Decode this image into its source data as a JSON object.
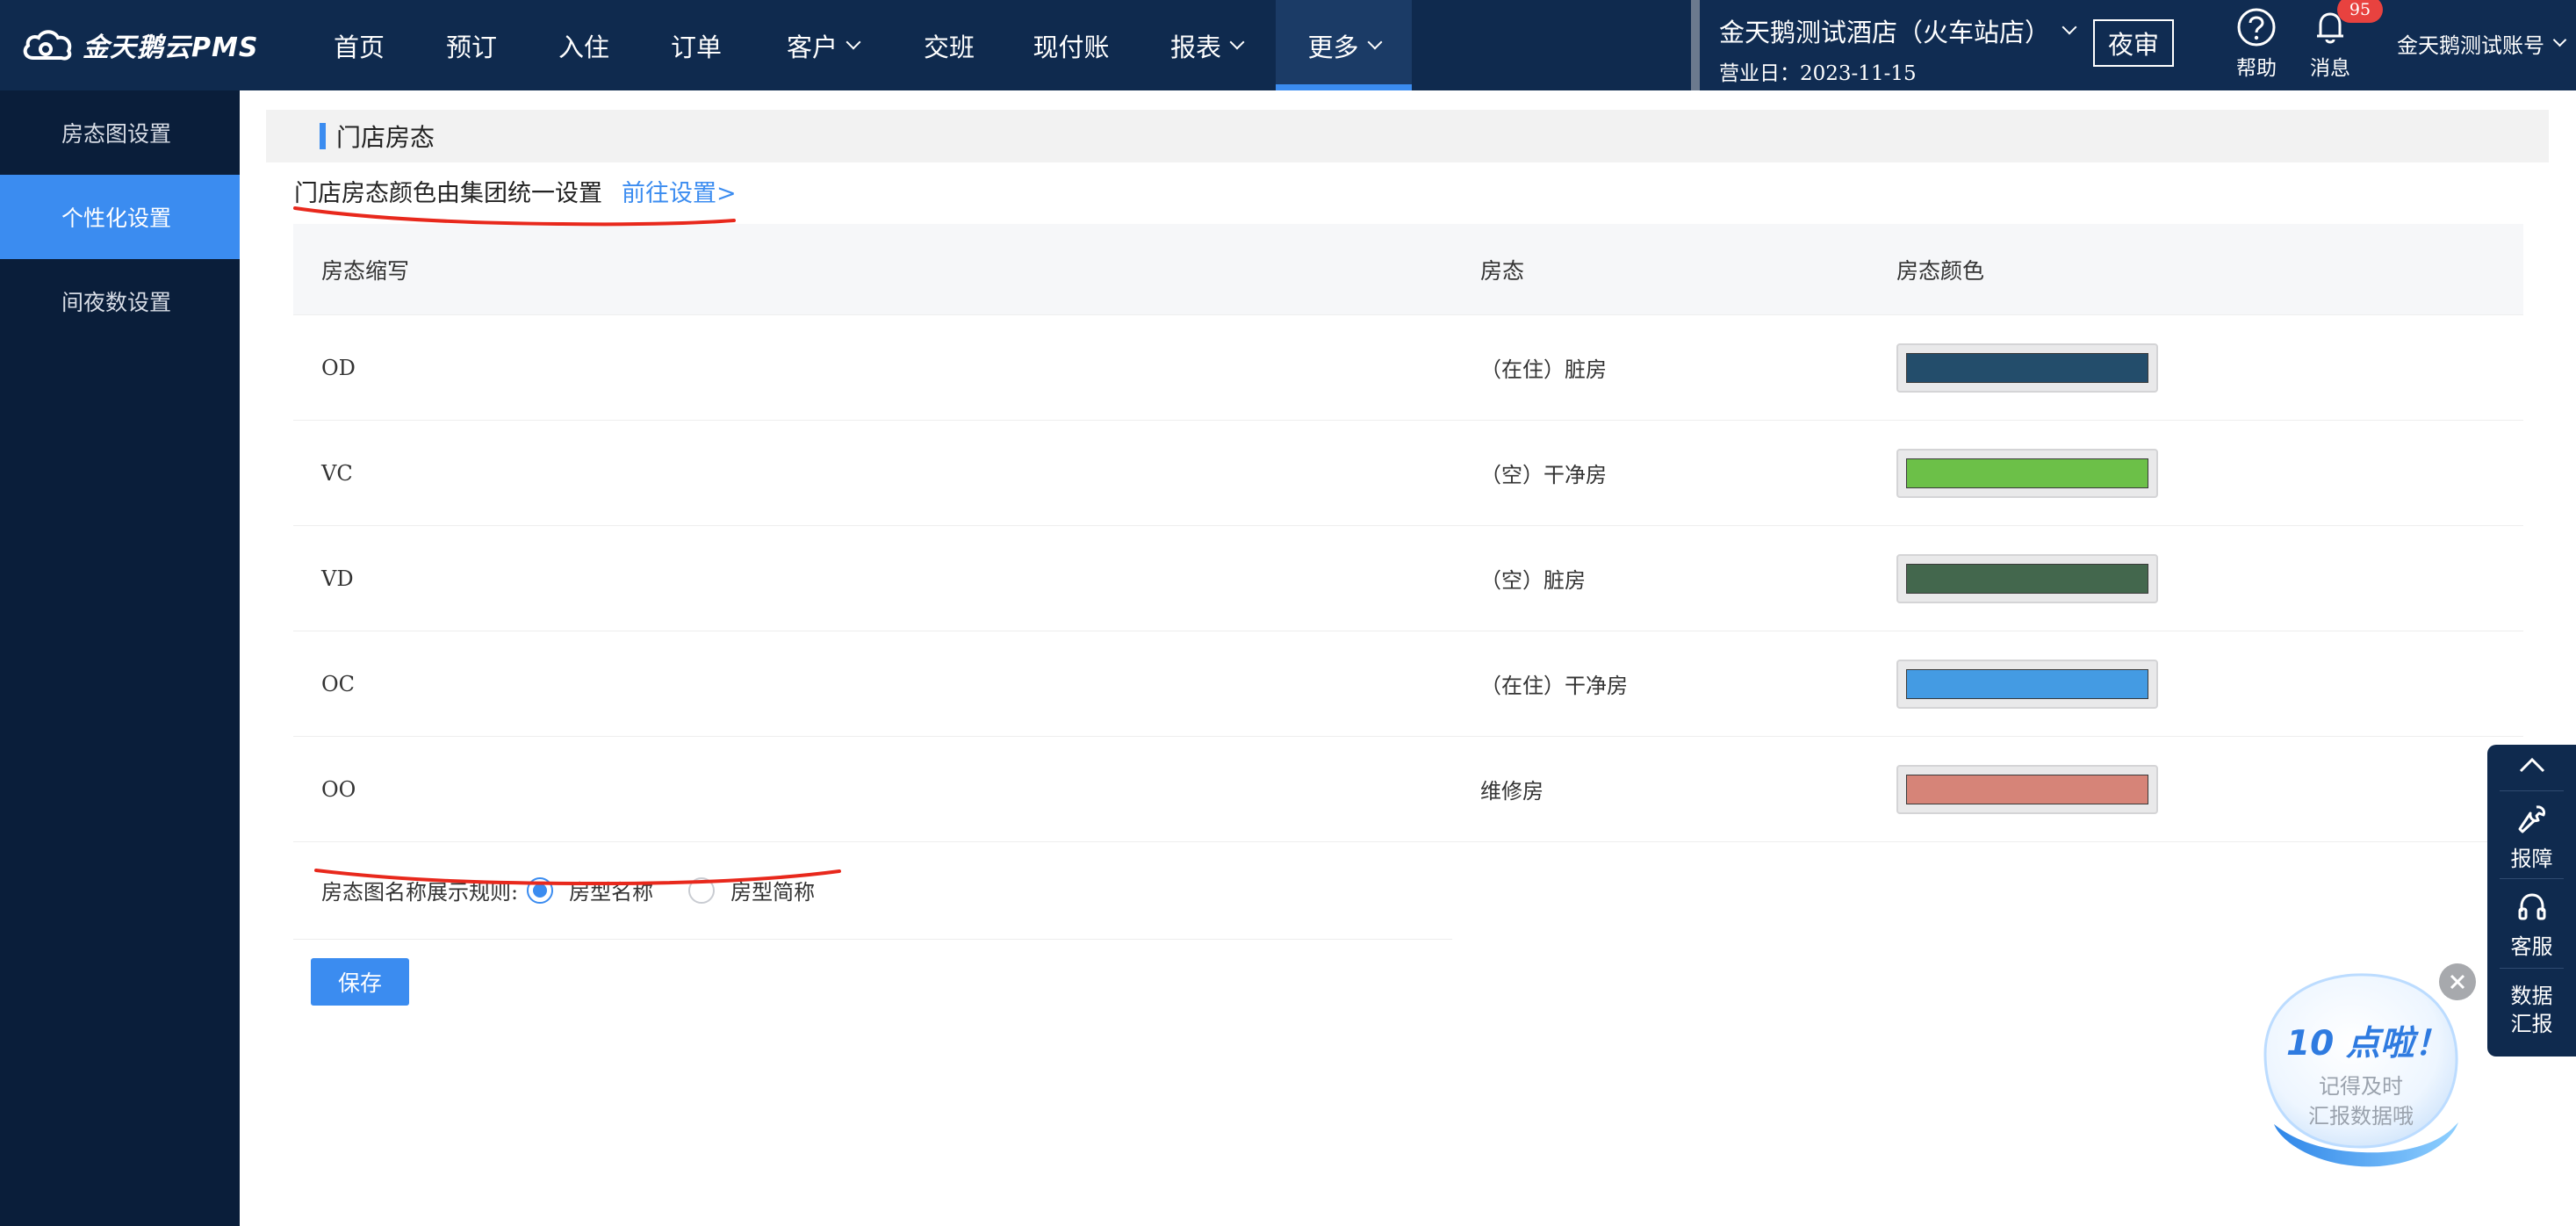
{
  "app": {
    "logo_text": "金天鹅云PMS"
  },
  "nav": {
    "items": [
      {
        "label": "首页"
      },
      {
        "label": "预订"
      },
      {
        "label": "入住"
      },
      {
        "label": "订单"
      },
      {
        "label": "客户"
      },
      {
        "label": "交班"
      },
      {
        "label": "现付账"
      },
      {
        "label": "报表"
      },
      {
        "label": "更多"
      }
    ]
  },
  "hotel": {
    "name": "金天鹅测试酒店（火车站店）",
    "business_date": "营业日：2023-11-15"
  },
  "header_actions": {
    "night_audit": "夜审",
    "help": "帮助",
    "messages": "消息",
    "message_count": "95",
    "account": "金天鹅测试账号"
  },
  "sidebar": {
    "items": [
      {
        "label": "房态图设置"
      },
      {
        "label": "个性化设置"
      },
      {
        "label": "间夜数设置"
      }
    ]
  },
  "main": {
    "section_title": "门店房态",
    "notice": "门店房态颜色由集团统一设置",
    "notice_link": "前往设置>",
    "table": {
      "headers": {
        "abbr": "房态缩写",
        "status": "房态",
        "color": "房态颜色"
      },
      "rows": [
        {
          "abbr": "OD",
          "status": "（在住）脏房",
          "color": "#234d6b"
        },
        {
          "abbr": "VC",
          "status": "（空）干净房",
          "color": "#6cc048"
        },
        {
          "abbr": "VD",
          "status": "（空）脏房",
          "color": "#43674d"
        },
        {
          "abbr": "OC",
          "status": "（在住）干净房",
          "color": "#449be3"
        },
        {
          "abbr": "OO",
          "status": "维修房",
          "color": "#d68478"
        }
      ]
    },
    "rule": {
      "label": "房态图名称展示规则:",
      "options": [
        "房型名称",
        "房型简称"
      ],
      "selected": "房型名称"
    },
    "save_label": "保存"
  },
  "float_bar": {
    "report_issue": "报障",
    "service": "客服",
    "data_report_line1": "数据",
    "data_report_line2": "汇报"
  },
  "reminder": {
    "title": "10 点啦！",
    "line1": "记得及时",
    "line2": "汇报数据哦"
  },
  "colors": {
    "accent": "#3b8cf0",
    "topbar": "#0f2a4e",
    "sidebar": "#0a1e3a",
    "annotation_red": "#e8281c"
  }
}
